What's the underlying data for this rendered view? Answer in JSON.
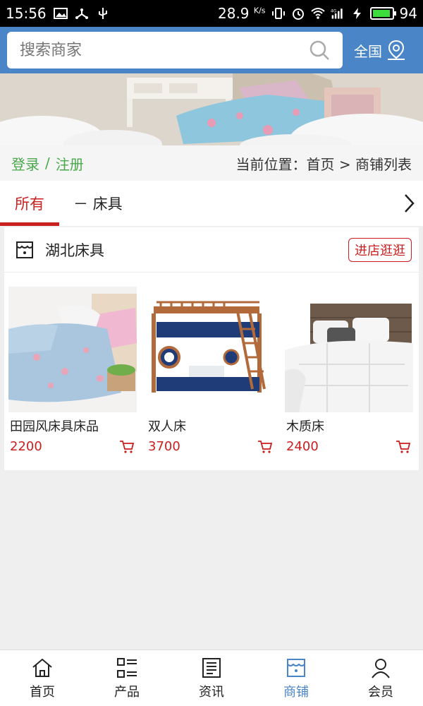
{
  "statusbar": {
    "time": "15:56",
    "speed": "28.9",
    "speed_unit": "K/s",
    "network": "4G",
    "battery": "94"
  },
  "header": {
    "search_placeholder": "搜索商家",
    "region_label": "全国"
  },
  "login": {
    "login": "登录",
    "separator": "/",
    "register": "注册",
    "breadcrumb": "当前位置：首页 > 商铺列表"
  },
  "tabs": {
    "all": "所有",
    "bedding": "－ 床具"
  },
  "shop": {
    "name": "湖北床具",
    "enter_label": "进店逛逛",
    "products": [
      {
        "name": "田园风床具床品",
        "price": "2200"
      },
      {
        "name": "双人床",
        "price": "3700"
      },
      {
        "name": "木质床",
        "price": "2400"
      }
    ]
  },
  "nav": [
    {
      "label": "首页",
      "icon": "home-icon"
    },
    {
      "label": "产品",
      "icon": "list-icon"
    },
    {
      "label": "资讯",
      "icon": "news-icon"
    },
    {
      "label": "商铺",
      "icon": "shop-icon"
    },
    {
      "label": "会员",
      "icon": "user-icon"
    }
  ],
  "colors": {
    "header": "#4a85c7",
    "accent_red": "#c91f1f",
    "login_green": "#4aa84a"
  }
}
